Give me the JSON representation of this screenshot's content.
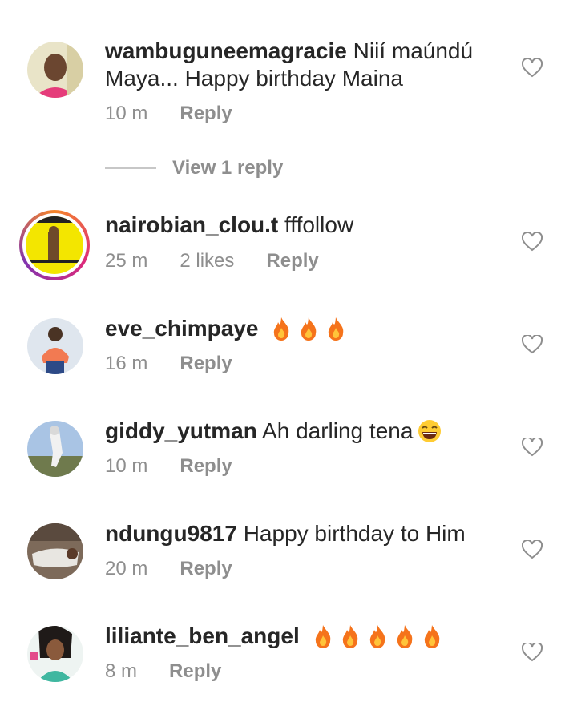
{
  "comments": [
    {
      "username": "wambuguneemagracie",
      "text_line1": "Niií maúndú",
      "text_line2": "Maya... Happy birthday Maina",
      "time": "10 m",
      "likes": "",
      "reply": "Reply"
    },
    {
      "username": "nairobian_clou.t",
      "text": "fffollow",
      "time": "25 m",
      "likes": "2 likes",
      "reply": "Reply"
    },
    {
      "username": "eve_chimpaye",
      "text": "",
      "emoji_fire_count": 3,
      "time": "16 m",
      "reply": "Reply"
    },
    {
      "username": "giddy_yutman",
      "text": "Ah darling tena",
      "emoji": "laughing-emoji",
      "time": "10 m",
      "reply": "Reply"
    },
    {
      "username": "ndungu9817",
      "text": "Happy birthday to Him",
      "time": "20 m",
      "reply": "Reply"
    },
    {
      "username": "liliante_ben_angel",
      "text": "",
      "emoji_fire_count": 5,
      "time": "8 m",
      "reply": "Reply"
    }
  ],
  "view_replies": "View 1 reply",
  "colors": {
    "text": "#262626",
    "muted": "#8e8e8e",
    "divider": "#c7c7c7",
    "fire": "#f5731b"
  }
}
